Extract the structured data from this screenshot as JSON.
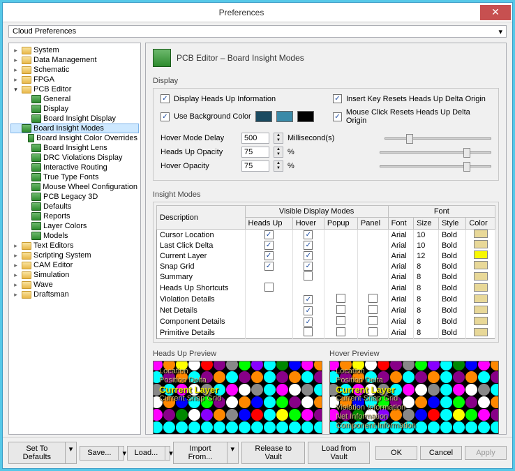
{
  "window": {
    "title": "Preferences"
  },
  "cloud": {
    "label": "Cloud Preferences"
  },
  "tree": {
    "items": [
      {
        "label": "System",
        "icon": "folder",
        "exp": "closed",
        "indent": 0
      },
      {
        "label": "Data Management",
        "icon": "folder",
        "exp": "closed",
        "indent": 0
      },
      {
        "label": "Schematic",
        "icon": "folder",
        "exp": "closed",
        "indent": 0
      },
      {
        "label": "FPGA",
        "icon": "folder",
        "exp": "closed",
        "indent": 0
      },
      {
        "label": "PCB Editor",
        "icon": "folder",
        "exp": "open",
        "indent": 0
      },
      {
        "label": "General",
        "icon": "pcb",
        "indent": 1
      },
      {
        "label": "Display",
        "icon": "pcb",
        "indent": 1
      },
      {
        "label": "Board Insight Display",
        "icon": "pcb",
        "indent": 1
      },
      {
        "label": "Board Insight Modes",
        "icon": "pcb",
        "indent": 1,
        "selected": true
      },
      {
        "label": "Board Insight Color Overrides",
        "icon": "pcb",
        "indent": 1
      },
      {
        "label": "Board Insight Lens",
        "icon": "pcb",
        "indent": 1
      },
      {
        "label": "DRC Violations Display",
        "icon": "pcb",
        "indent": 1
      },
      {
        "label": "Interactive Routing",
        "icon": "pcb",
        "indent": 1
      },
      {
        "label": "True Type Fonts",
        "icon": "pcb",
        "indent": 1
      },
      {
        "label": "Mouse Wheel Configuration",
        "icon": "pcb",
        "indent": 1
      },
      {
        "label": "PCB Legacy 3D",
        "icon": "pcb",
        "indent": 1
      },
      {
        "label": "Defaults",
        "icon": "pcb",
        "indent": 1
      },
      {
        "label": "Reports",
        "icon": "pcb",
        "indent": 1
      },
      {
        "label": "Layer Colors",
        "icon": "pcb",
        "indent": 1
      },
      {
        "label": "Models",
        "icon": "pcb",
        "indent": 1
      },
      {
        "label": "Text Editors",
        "icon": "folder",
        "exp": "closed",
        "indent": 0
      },
      {
        "label": "Scripting System",
        "icon": "folder",
        "exp": "closed",
        "indent": 0
      },
      {
        "label": "CAM Editor",
        "icon": "folder",
        "exp": "closed",
        "indent": 0
      },
      {
        "label": "Simulation",
        "icon": "folder",
        "exp": "closed",
        "indent": 0
      },
      {
        "label": "Wave",
        "icon": "folder",
        "exp": "closed",
        "indent": 0
      },
      {
        "label": "Draftsman",
        "icon": "folder",
        "exp": "closed",
        "indent": 0
      }
    ]
  },
  "page": {
    "title": "PCB Editor – Board Insight Modes"
  },
  "display": {
    "section": "Display",
    "headsUp": {
      "label": "Display Heads Up Information",
      "checked": true
    },
    "bgColor": {
      "label": "Use Background Color",
      "checked": true,
      "c1": "#1a4a60",
      "c2": "#3a8aa8",
      "c3": "#000000"
    },
    "insertKey": {
      "label": "Insert Key Resets Heads Up Delta Origin",
      "checked": true
    },
    "mouseClick": {
      "label": "Mouse Click Resets Heads Up Delta Origin",
      "checked": true
    },
    "hoverDelay": {
      "label": "Hover Mode Delay",
      "value": "500",
      "unit": "Millisecond(s)"
    },
    "headsOpacity": {
      "label": "Heads Up Opacity",
      "value": "75",
      "unit": "%"
    },
    "hoverOpacity": {
      "label": "Hover Opacity",
      "value": "75",
      "unit": "%"
    }
  },
  "insight": {
    "section": "Insight Modes",
    "headers": {
      "group1": "Visible Display Modes",
      "group2": "Font",
      "desc": "Description",
      "headsUp": "Heads Up",
      "hover": "Hover",
      "popup": "Popup",
      "panel": "Panel",
      "font": "Font",
      "size": "Size",
      "style": "Style",
      "color": "Color"
    },
    "rows": [
      {
        "desc": "Cursor Location",
        "hu": true,
        "hv": true,
        "pp": null,
        "pn": null,
        "font": "Arial",
        "size": "10",
        "style": "Bold",
        "color": "#e8d898"
      },
      {
        "desc": "Last Click Delta",
        "hu": true,
        "hv": true,
        "pp": null,
        "pn": null,
        "font": "Arial",
        "size": "10",
        "style": "Bold",
        "color": "#e8d898"
      },
      {
        "desc": "Current Layer",
        "hu": true,
        "hv": true,
        "pp": null,
        "pn": null,
        "font": "Arial",
        "size": "12",
        "style": "Bold",
        "color": "#f8f800"
      },
      {
        "desc": "Snap Grid",
        "hu": true,
        "hv": true,
        "pp": null,
        "pn": null,
        "font": "Arial",
        "size": "8",
        "style": "Bold",
        "color": "#e8d898"
      },
      {
        "desc": "Summary",
        "hu": null,
        "hv": false,
        "pp": null,
        "pn": null,
        "font": "Arial",
        "size": "8",
        "style": "Bold",
        "color": "#e8d898"
      },
      {
        "desc": "Heads Up Shortcuts",
        "hu": false,
        "hv": null,
        "pp": null,
        "pn": null,
        "font": "Arial",
        "size": "8",
        "style": "Bold",
        "color": "#e8d898"
      },
      {
        "desc": "Violation Details",
        "hu": null,
        "hv": true,
        "pp": false,
        "pn": false,
        "font": "Arial",
        "size": "8",
        "style": "Bold",
        "color": "#e8d898"
      },
      {
        "desc": "Net Details",
        "hu": null,
        "hv": true,
        "pp": false,
        "pn": false,
        "font": "Arial",
        "size": "8",
        "style": "Bold",
        "color": "#e8d898"
      },
      {
        "desc": "Component Details",
        "hu": null,
        "hv": true,
        "pp": false,
        "pn": false,
        "font": "Arial",
        "size": "8",
        "style": "Bold",
        "color": "#e8d898"
      },
      {
        "desc": "Primitive Details",
        "hu": null,
        "hv": false,
        "pp": false,
        "pn": false,
        "font": "Arial",
        "size": "8",
        "style": "Bold",
        "color": "#e8d898"
      }
    ]
  },
  "previews": {
    "headsUp": {
      "label": "Heads Up Preview",
      "lines": [
        "Location",
        "Position Delta"
      ],
      "big": "Current Layer",
      "after": [
        "Current Snap Grid"
      ]
    },
    "hover": {
      "label": "Hover Preview",
      "lines": [
        "Location",
        "Position Delta"
      ],
      "big": "Current Layer",
      "after": [
        "Current Snap Grid",
        "Violation Information",
        "Net Information",
        "Component Information"
      ]
    }
  },
  "footer": {
    "defaults": "Set To Defaults",
    "save": "Save...",
    "load": "Load...",
    "import": "Import From...",
    "release": "Release to Vault",
    "loadVault": "Load from Vault",
    "ok": "OK",
    "cancel": "Cancel",
    "apply": "Apply"
  },
  "dotColors": [
    "#ff00ff",
    "#00ff00",
    "#ffff00",
    "#00ffff",
    "#ff0000",
    "#0000ff",
    "#888888",
    "#ff8800",
    "#8800ff",
    "#ffffff",
    "#008800",
    "#880088"
  ]
}
